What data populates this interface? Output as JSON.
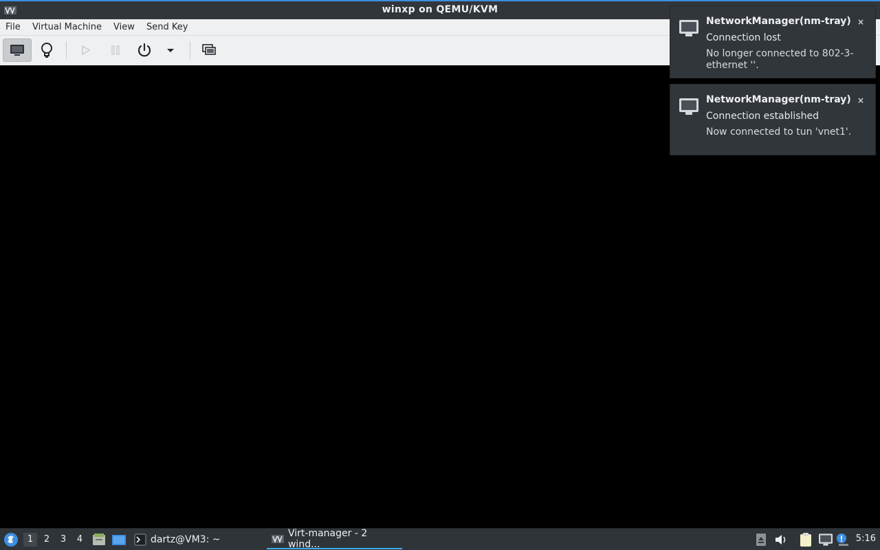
{
  "window": {
    "title": "winxp on QEMU/KVM",
    "app_icon": "virt-manager-icon"
  },
  "menu": {
    "items": [
      "File",
      "Virtual Machine",
      "View",
      "Send Key"
    ]
  },
  "toolbar": {
    "buttons": [
      {
        "icon": "monitor-icon",
        "state": "active"
      },
      {
        "icon": "lightbulb-icon"
      },
      {
        "icon": "play-icon",
        "state": "disabled"
      },
      {
        "icon": "pause-icon",
        "state": "disabled"
      },
      {
        "icon": "power-icon"
      },
      {
        "icon": "chevron-down-icon"
      },
      {
        "icon": "fullscreen-icon"
      }
    ]
  },
  "notifications": [
    {
      "icon": "network-wired-icon",
      "title": "NetworkManager(nm-tray)",
      "subject": "Connection lost",
      "body": "No longer connected to 802-3-ethernet ''.",
      "close": "×"
    },
    {
      "icon": "network-wired-icon",
      "title": "NetworkManager(nm-tray)",
      "subject": "Connection established",
      "body": "Now connected to tun 'vnet1'.",
      "close": "×"
    }
  ],
  "taskbar": {
    "start_icon": "lxqt-start-icon",
    "desktops": [
      "1",
      "2",
      "3",
      "4"
    ],
    "active_desktop": "1",
    "quicklaunch": [
      "file-manager-icon",
      "show-desktop-icon"
    ],
    "tasks": [
      {
        "icon": "terminal-icon",
        "label": "dartz@VM3: ~"
      },
      {
        "icon": "virt-manager-icon",
        "label": "Virt-manager - 2 wind...",
        "active": true
      }
    ],
    "tray": [
      "eject-icon",
      "volume-icon",
      "clipboard-icon",
      "network-wired-icon",
      "update-notifier-icon"
    ],
    "clock": "5:16"
  },
  "colors": {
    "accent": "#3daee9",
    "titlebar_bg": "#31363b",
    "menubar_bg": "#eff0f1",
    "display_bg": "#000000"
  }
}
